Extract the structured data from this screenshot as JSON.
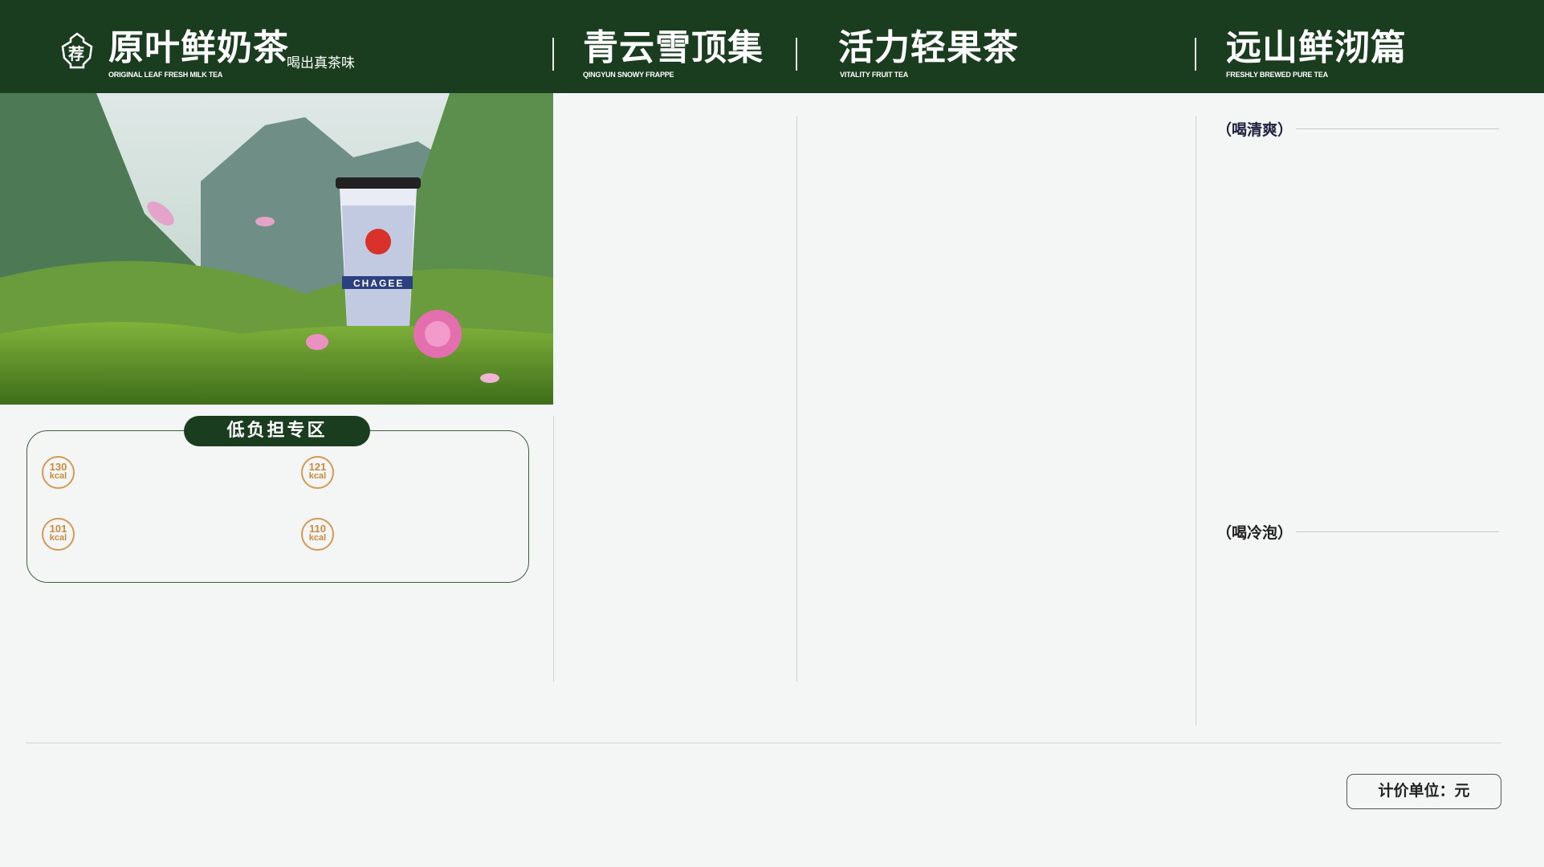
{
  "header": {
    "logo_char": "荐",
    "main_category": {
      "title": "原叶鲜奶茶",
      "subtitle": "喝出真茶味",
      "english": "ORIGINAL LEAF FRESH MILK TEA"
    },
    "categories": [
      {
        "title": "青云雪顶集",
        "english": "QINGYUN SNOWY FRAPPE"
      },
      {
        "title": "活力轻果茶",
        "english": "VITALITY FRUIT TEA"
      },
      {
        "title": "远山鲜沏篇",
        "english": "FRESHLY BREWED PURE TEA"
      }
    ]
  },
  "hero": {
    "cup_brand": "CHAGEE"
  },
  "low_calorie": {
    "title": "低负担专区",
    "badges": [
      {
        "value": "130",
        "unit": "kcal"
      },
      {
        "value": "121",
        "unit": "kcal"
      },
      {
        "value": "101",
        "unit": "kcal"
      },
      {
        "value": "110",
        "unit": "kcal"
      }
    ]
  },
  "pure_tea": {
    "sections": [
      "（喝清爽）",
      "（喝冷泡）"
    ]
  },
  "footer": {
    "price_unit": "计价单位：元"
  },
  "colors": {
    "brand_green": "#1b3d1f",
    "kcal_orange": "#d39a54",
    "background": "#f4f6f5"
  }
}
